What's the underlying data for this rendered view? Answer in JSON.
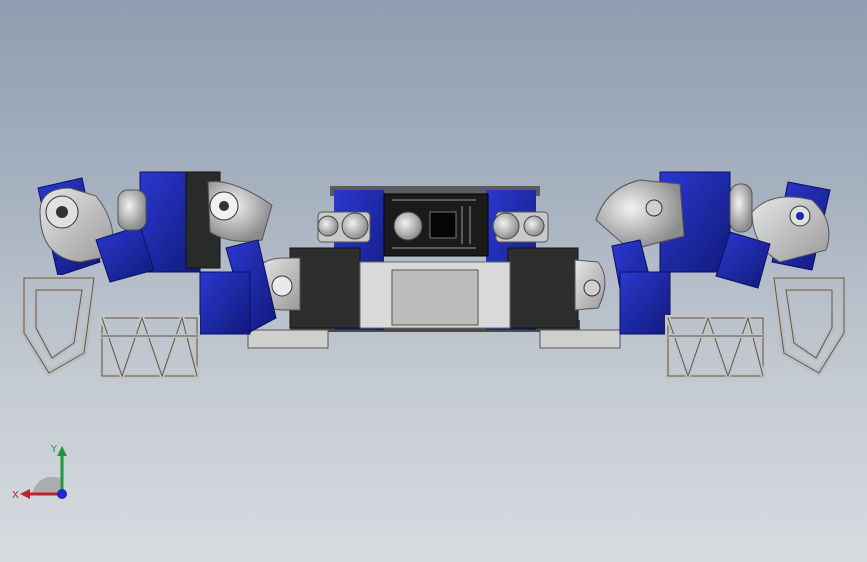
{
  "triad": {
    "x_label": "X",
    "y_label": "Y",
    "colors": {
      "x": "#c0202a",
      "y": "#1e9a3a",
      "z": "#1f2ac8"
    }
  },
  "colors": {
    "servo_blue": "#1c27b0",
    "servo_dark_blue": "#101a7a",
    "bracket_gray": "#c8c8c8",
    "dark_gray": "#3a3a3a",
    "background_top": "#8e9db0",
    "background_bottom": "#d8dbe0"
  }
}
